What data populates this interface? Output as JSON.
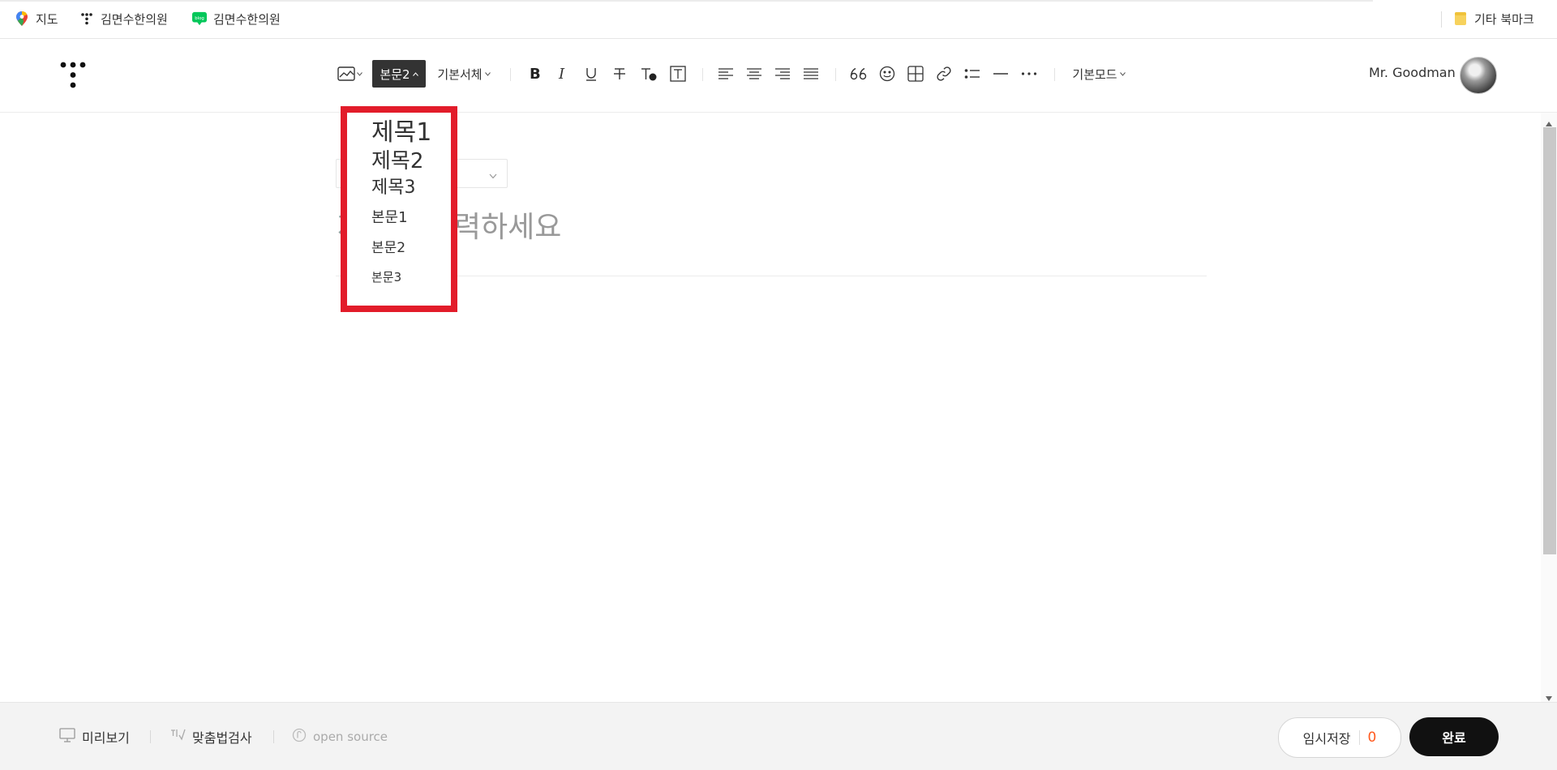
{
  "bookmarks": [
    {
      "label": "지도",
      "icon": "map-pin-icon"
    },
    {
      "label": "김면수한의원",
      "icon": "tistory-icon"
    },
    {
      "label": "김면수한의원",
      "icon": "blog-icon",
      "badge": "blog"
    }
  ],
  "bookmarks_other": {
    "label": "기타 북마크",
    "icon": "folder-icon"
  },
  "toolbar": {
    "paragraph_style": "본문2",
    "font": "기본서체",
    "mode": "기본모드",
    "icons": [
      "image-icon",
      "bold-icon",
      "italic-icon",
      "underline-icon",
      "strikethrough-icon",
      "text-color-icon",
      "text-background-icon",
      "align-left-icon",
      "align-center-icon",
      "align-right-icon",
      "align-justify-icon",
      "quote-icon",
      "emoji-icon",
      "table-icon",
      "link-icon",
      "list-icon",
      "divider-icon",
      "more-icon"
    ]
  },
  "user": {
    "name": "Mr. Goodman"
  },
  "editor": {
    "title_placeholder": "제목을 입력하세요"
  },
  "dropdown": {
    "items": [
      {
        "label": "제목1"
      },
      {
        "label": "제목2"
      },
      {
        "label": "제목3"
      },
      {
        "label": "본문1"
      },
      {
        "label": "본문2"
      },
      {
        "label": "본문3"
      }
    ]
  },
  "footer": {
    "preview": "미리보기",
    "spellcheck": "맞춤법검사",
    "opensource": "open source",
    "temp_save": "임시저장",
    "temp_count": "0",
    "done": "완료"
  },
  "colors": {
    "highlight": "#e21c2a",
    "accent_count": "#ff5a1f",
    "done_bg": "#111111"
  }
}
